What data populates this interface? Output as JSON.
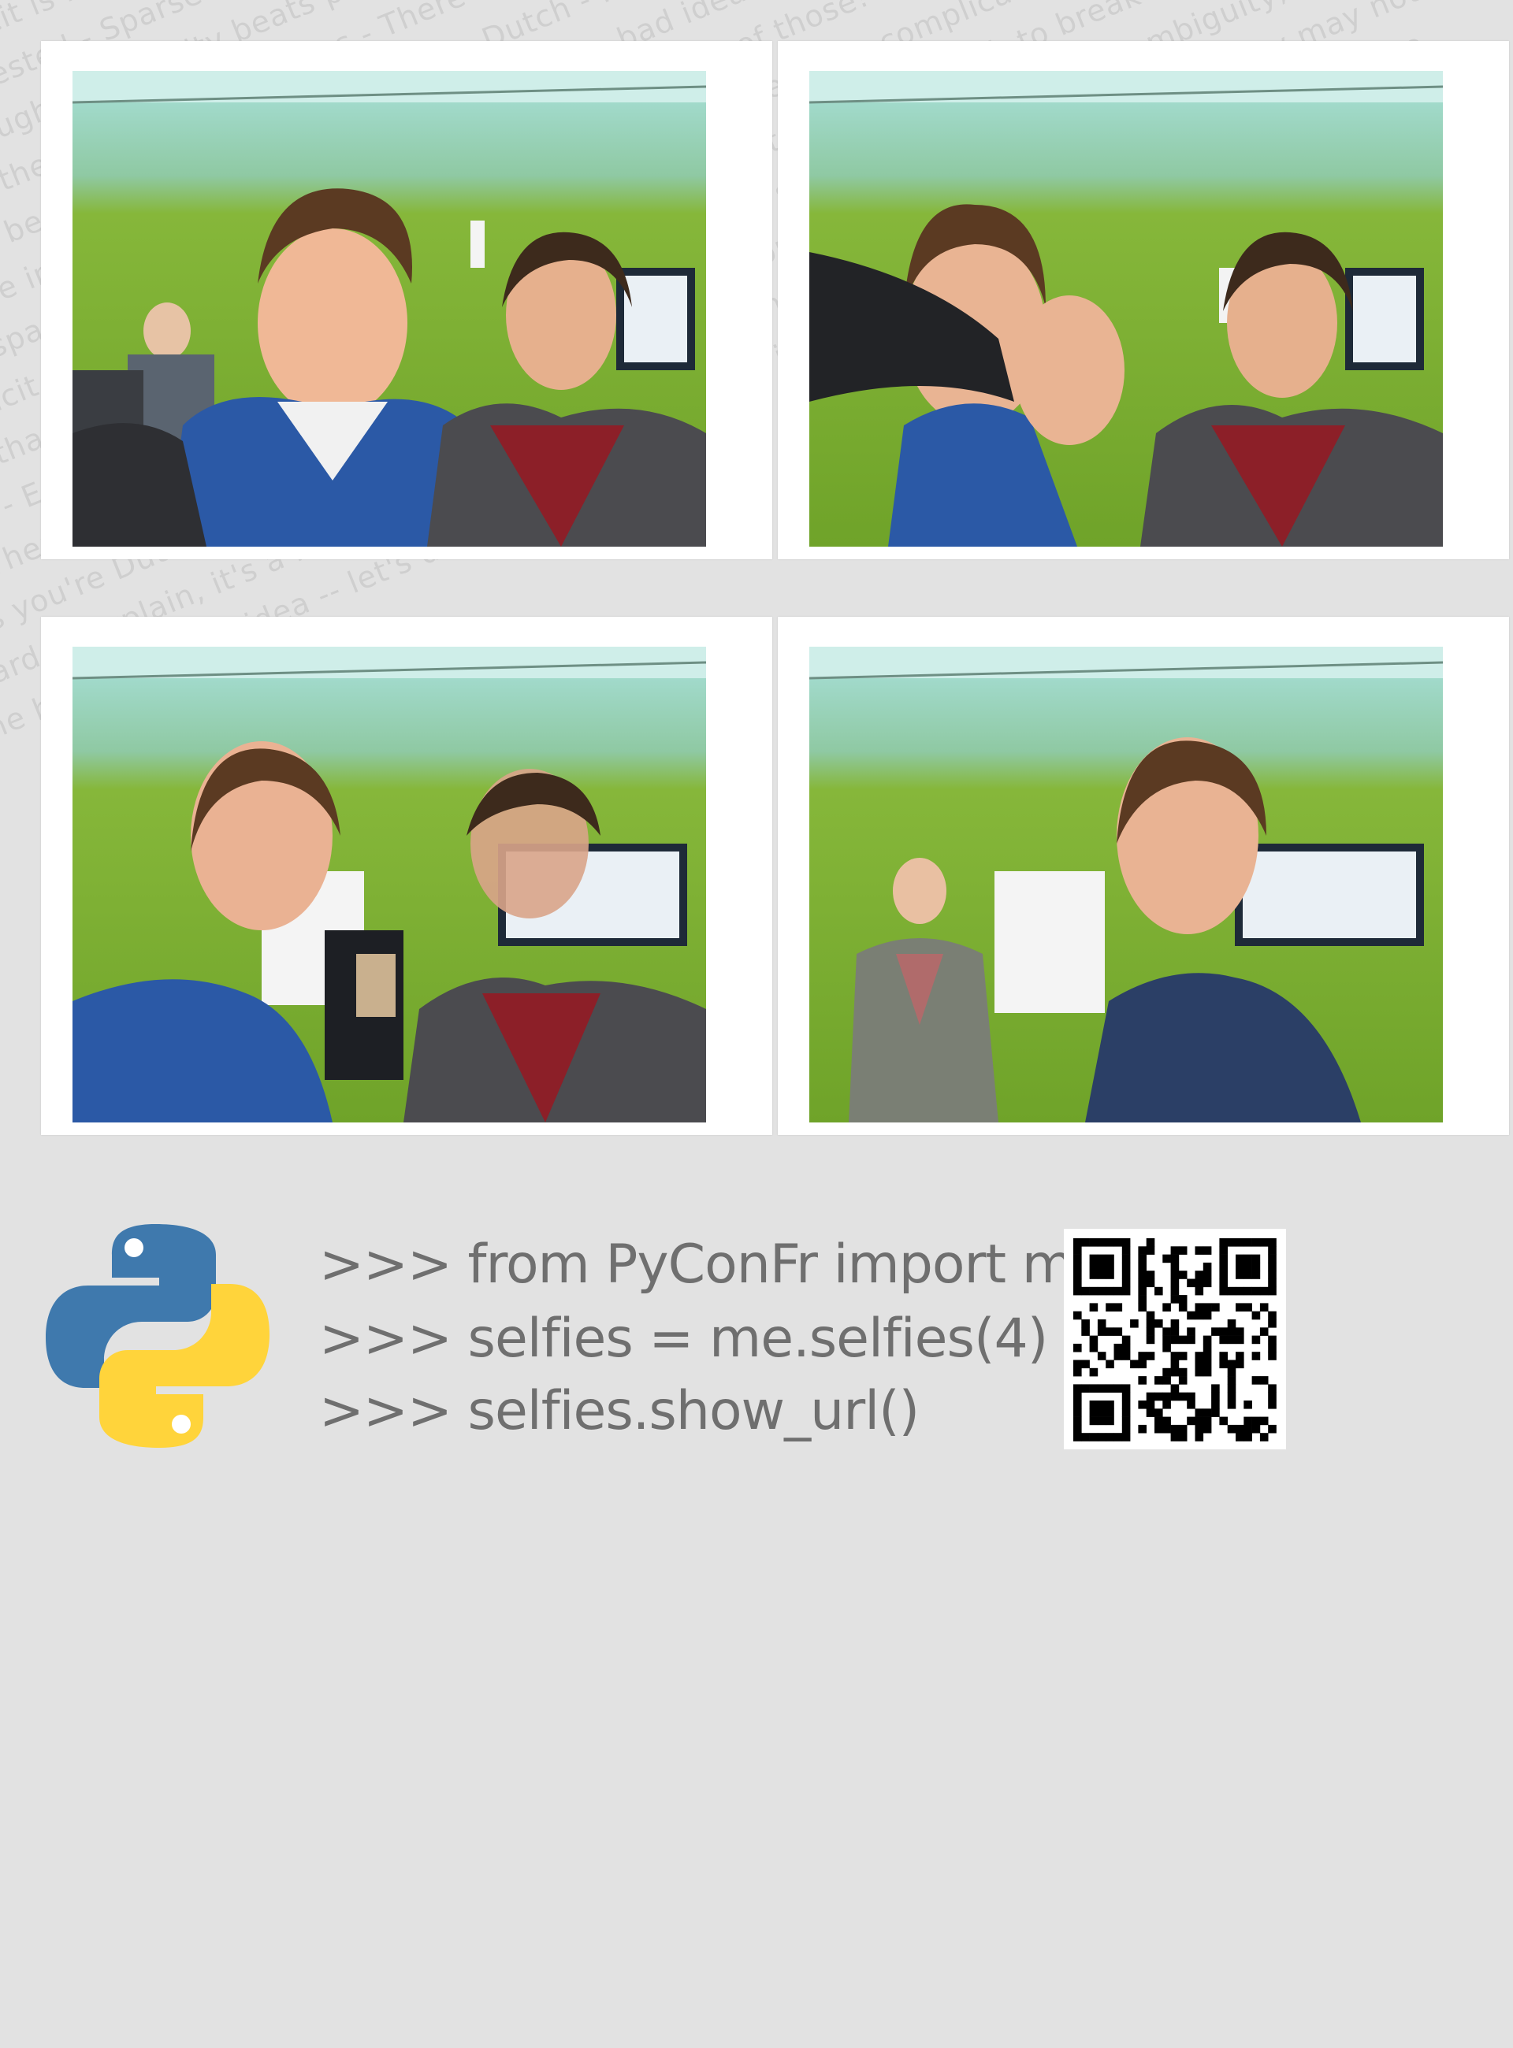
{
  "background_text": "Beautiful is better than ugly - Explicit is better than implicit - Simple is better than complex - Complex is better than complicated - Flat is better than nested - Sparse is better than dense - Readability counts - Special cases aren't special enough to break the rules - Although practicality beats purity - Errors should never pass silently - Unless explicitly silenced - In the face of ambiguity, refuse the temptation to guess - There should be one-- and preferably only one --obvious way to do it - Although that way may not be obvious at first unless you're Dutch - Now is better than never - Although never is often better than *right* now - If the implementation is hard to explain, it's a bad idea - If the implementation is easy to explain, it may be a good idea - Namespaces are one honking great idea -- let's do more of those! - Beautiful is better than ugly - Explicit is better than implicit - Simple is better than complex - Complex is better than complicated - Flat is better than nested - Sparse is better than dense - Readability counts - Special cases aren't special enough to break the rules - Although practicality beats purity - Errors should never pass silently - Unless explicitly silenced - In the face of ambiguity, refuse the temptation to guess - There should be one-- and preferably only one --obvious way to do it - Although that way may not be obvious at first unless you're Dutch - Now is better than never - Although never is often better than *right* now - If the implementation is hard to explain, it's a bad idea - If the implementation is easy to explain, it may be a good idea - Namespaces are one honking great idea -- let's do more of those!",
  "code_lines": [
    ">>> from PyConFr import me",
    ">>> selfies = me.selfies(4)",
    ">>> selfies.show_url()"
  ],
  "colors": {
    "wall_green": "#7fb22c",
    "python_blue": "#3f79ad",
    "python_yellow": "#ffd43b",
    "code_text": "#6f6f6f"
  },
  "icons": {
    "python_logo": "python-logo-icon",
    "qr_code": "qr-code-icon"
  }
}
